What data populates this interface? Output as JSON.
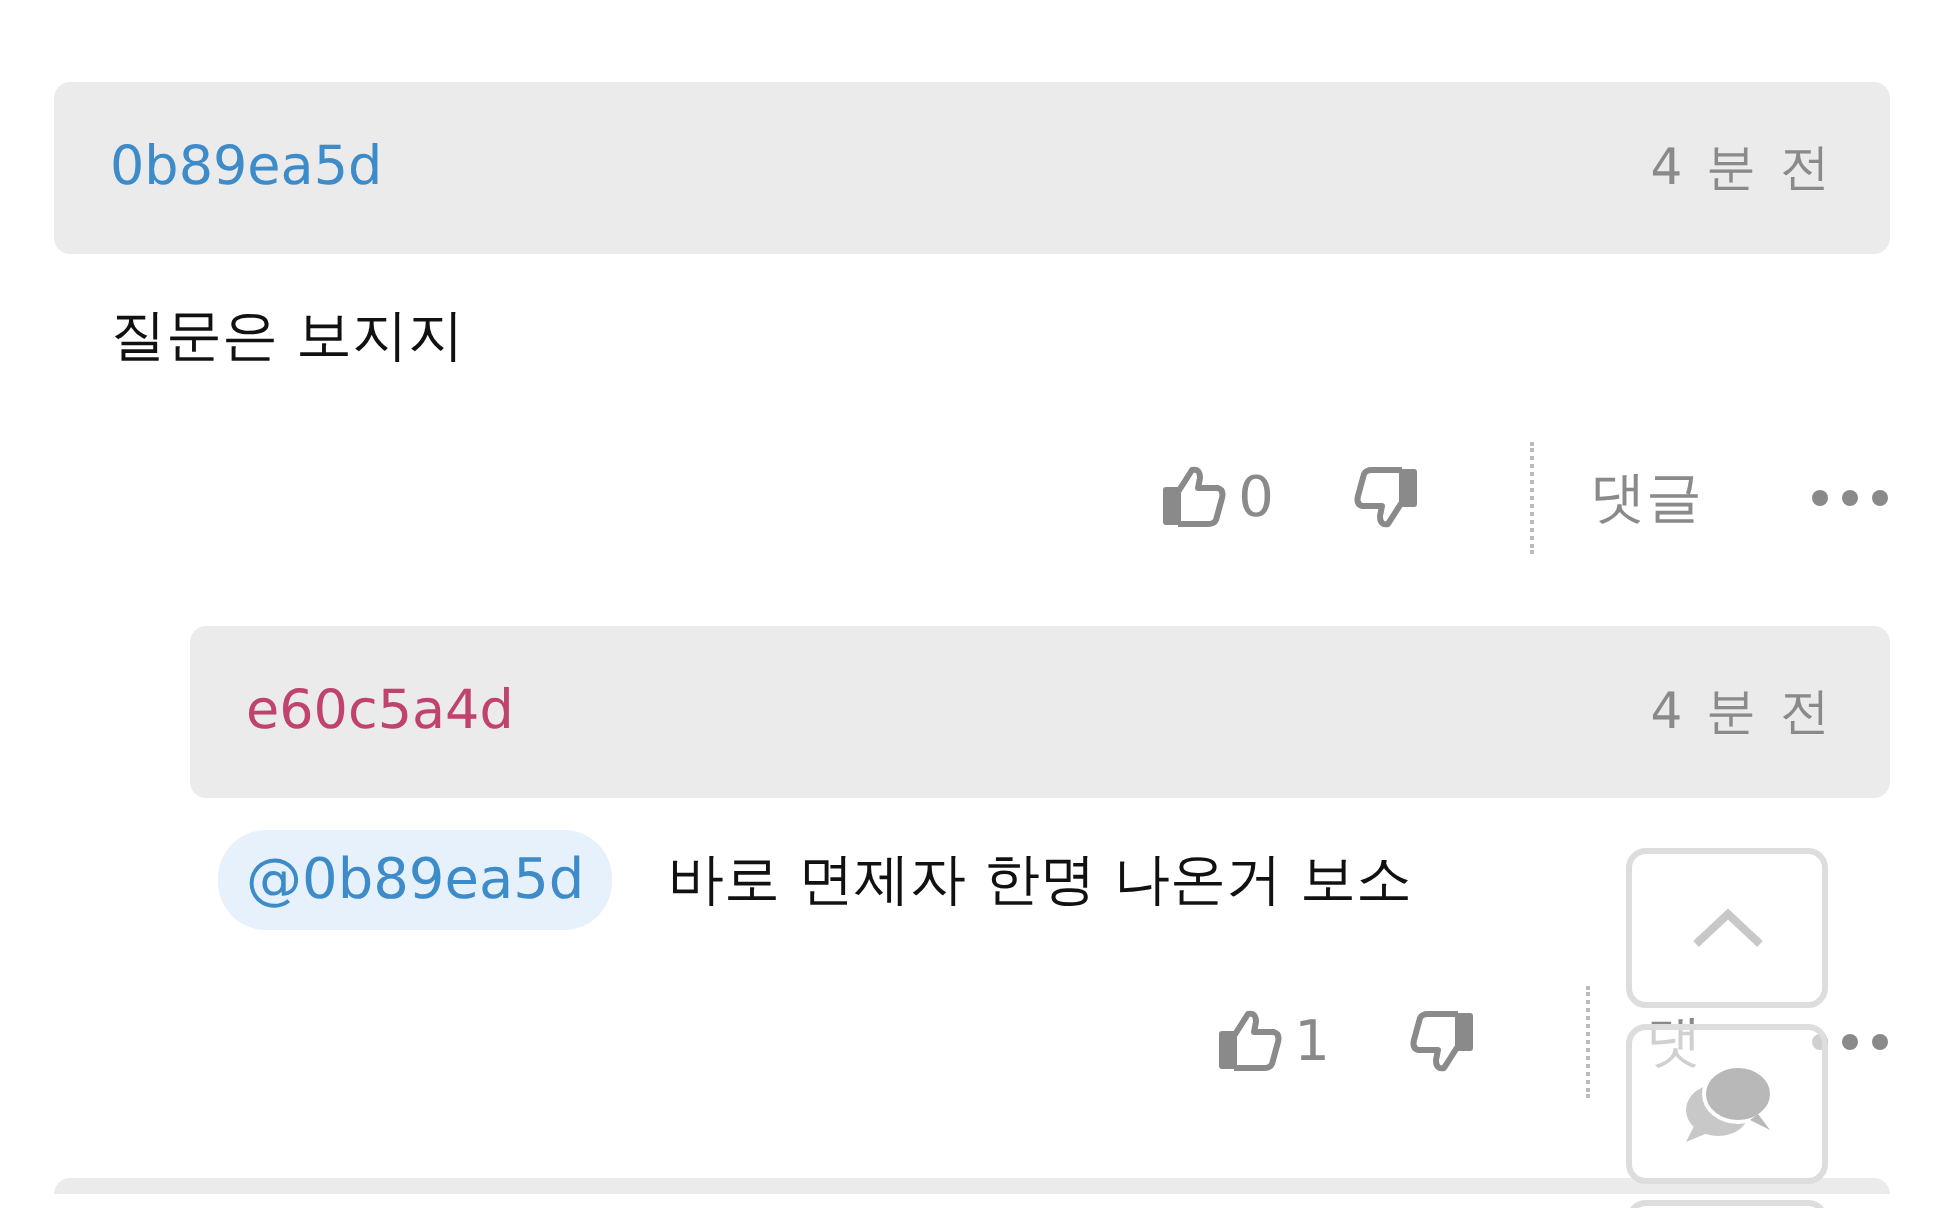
{
  "comments": [
    {
      "author": "0b89ea5d",
      "color": "#3d8bc9",
      "time": "4 분 전",
      "text": "질문은 보지지",
      "likes": "0",
      "reply_label": "댓글",
      "reply": false
    },
    {
      "author": "e60c5a4d",
      "color": "#c0436f",
      "time": "4 분 전",
      "mention": "@0b89ea5d",
      "text": "바로 면제자 한명 나온거 보소",
      "likes": "1",
      "reply_label": "댓",
      "reply": true
    }
  ]
}
